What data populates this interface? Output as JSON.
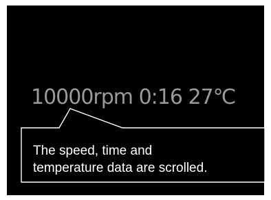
{
  "display": {
    "readout": "10000rpm 0:16 27℃",
    "background_color": "#000000",
    "readout_color": "#9a9a9a"
  },
  "callout": {
    "line1": "The speed, time and",
    "line2": "temperature data are scrolled."
  }
}
